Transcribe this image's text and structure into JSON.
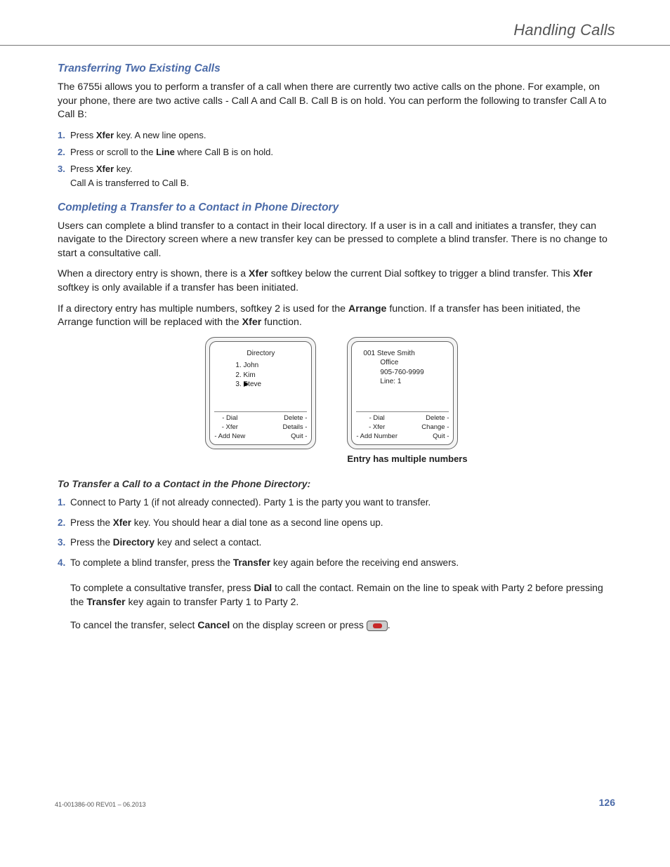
{
  "header": {
    "running": "Handling Calls"
  },
  "sec1": {
    "title": "Transferring Two Existing Calls",
    "intro": "The 6755i allows you to perform a transfer of a call when there are currently two active calls on the phone. For example, on your phone, there are two active calls - Call A and Call B. Call B is on hold. You can perform the following to transfer Call A to Call B:",
    "steps": [
      {
        "n": "1.",
        "pre": "Press ",
        "b": "Xfer",
        "post": " key. A new line opens."
      },
      {
        "n": "2.",
        "pre": "Press or scroll to the ",
        "b": "Line",
        "post": " where Call B is on hold."
      },
      {
        "n": "3.",
        "pre": "Press ",
        "b": "Xfer",
        "post": " key.",
        "sub": "Call A is transferred to Call B."
      }
    ]
  },
  "sec2": {
    "title": "Completing a Transfer to a Contact in Phone Directory",
    "p1": "Users can complete a blind transfer to a contact in their local directory. If a user is in a call and initiates a transfer, they can navigate to the Directory screen where a new transfer key can be pressed to complete a blind transfer. There is no change to start a consultative call.",
    "p2a": "When a directory entry is shown, there is a ",
    "p2b": "Xfer",
    "p2c": " softkey below the current Dial softkey to trigger a blind transfer. This ",
    "p2d": "Xfer",
    "p2e": " softkey is only available if a transfer has been initiated.",
    "p3a": "If a directory entry has multiple numbers, softkey 2 is used for the ",
    "p3b": "Arrange",
    "p3c": " function. If a transfer has been initiated, the Arrange function will be replaced with the ",
    "p3d": "Xfer",
    "p3e": " function."
  },
  "screen1": {
    "title": "Directory",
    "l1": "1. John",
    "l2": "2. Kim",
    "l3": "3. Steve",
    "sl1": "- Dial",
    "sr1": "Delete -",
    "sl2": "- Xfer",
    "sr2": "Details -",
    "sl3": "- Add New",
    "sr3": "Quit -"
  },
  "screen2": {
    "title": "001 Steve Smith",
    "l1": "Office",
    "l2": "905-760-9999",
    "l3": "Line: 1",
    "sl1": "- Dial",
    "sr1": "Delete -",
    "sl2": "- Xfer",
    "sr2": "Change -",
    "sl3": "- Add Number",
    "sr3": "Quit -",
    "caption": "Entry has multiple numbers"
  },
  "sec3": {
    "title": "To Transfer a Call to a Contact in the Phone Directory:",
    "s1": {
      "n": "1.",
      "t": "Connect to Party 1 (if not already connected). Party 1 is the party you want to transfer."
    },
    "s2": {
      "n": "2.",
      "a": "Press the ",
      "b": "Xfer",
      "c": " key. You should hear a dial tone as a second line opens up."
    },
    "s3": {
      "n": "3.",
      "a": "Press the ",
      "b": "Directory",
      "c": " key and select a contact."
    },
    "s4": {
      "n": "4.",
      "a": "To complete a blind transfer, press the ",
      "b": "Transfer",
      "c": " key again before the receiving end answers."
    },
    "extra1a": "To complete a consultative transfer, press ",
    "extra1b": "Dial",
    "extra1c": " to call the contact. Remain on the line to speak with Party 2 before pressing the ",
    "extra1d": "Transfer",
    "extra1e": " key again to transfer Party 1 to Party 2.",
    "extra2a": "To cancel the transfer, select ",
    "extra2b": "Cancel",
    "extra2c": " on the display screen or press ",
    "extra2d": "."
  },
  "footer": {
    "rev": "41-001386-00 REV01 – 06.2013",
    "page": "126"
  }
}
